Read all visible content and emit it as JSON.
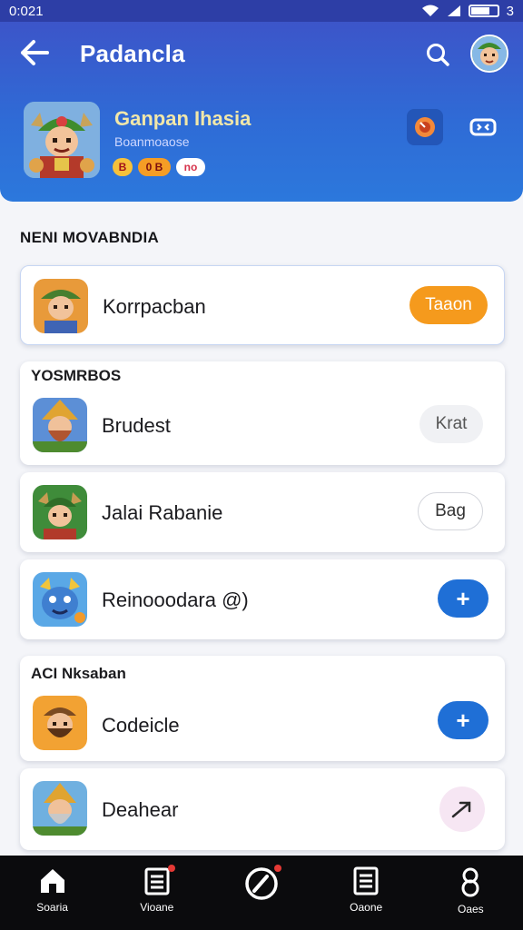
{
  "status_bar": {
    "time": "0:021",
    "battery": "3"
  },
  "app_bar": {
    "title": "Padancla"
  },
  "profile": {
    "name": "Ganpan Ihasia",
    "subtitle": "Boanmoaose",
    "badges": [
      "B",
      "0 B",
      "no"
    ]
  },
  "sections": {
    "first": "NENI MOVABNDIA",
    "second": "YOSMRBOS",
    "third": "ACI Nksaban"
  },
  "items": [
    {
      "label": "Korrpacban",
      "action": "Taaon"
    },
    {
      "label": "Brudest",
      "action": "Krat"
    },
    {
      "label": "Jalai Rabanie",
      "action": "Bag"
    },
    {
      "label": "Reinooodara @)",
      "action": "+"
    },
    {
      "label": "Codeicle",
      "action": "+"
    },
    {
      "label": "Deahear",
      "action": "arrow"
    }
  ],
  "bottom_nav": [
    {
      "label": "Soaria",
      "icon": "home-icon"
    },
    {
      "label": "Vioane",
      "icon": "list-icon"
    },
    {
      "label": "",
      "icon": "gauge-icon"
    },
    {
      "label": "Oaone",
      "icon": "document-icon"
    },
    {
      "label": "Oaes",
      "icon": "profile-icon"
    }
  ],
  "colors": {
    "header": "#2f6bd6",
    "accent_orange": "#f59a1d",
    "accent_blue": "#1f6fd6",
    "nav_bg": "#0b0b0d"
  }
}
